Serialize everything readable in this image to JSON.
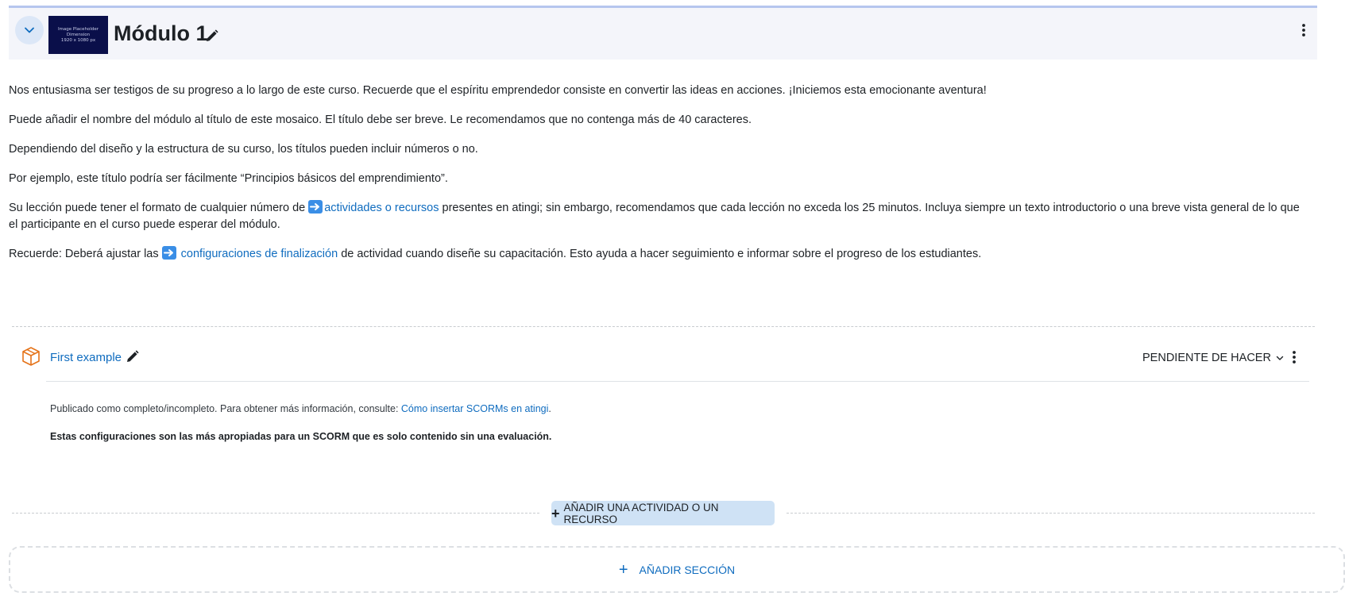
{
  "section": {
    "title": "Módulo 1",
    "thumbnail_text": "Image Placeholder\nDimension\n1920 x 1080 px"
  },
  "summary": {
    "p1": "Nos entusiasma ser testigos de su progreso a lo largo de este curso. Recuerde que el espíritu emprendedor consiste en convertir las ideas en acciones. ¡Iniciemos esta emocionante aventura!",
    "p2": "Puede añadir el nombre del módulo al título de este mosaico. El título debe ser breve. Le recomendamos que no contenga más de 40 caracteres.",
    "p3": "Dependiendo del diseño y la estructura de su curso, los títulos pueden incluir números o no.",
    "p4": "Por ejemplo, este título podría ser fácilmente “Principios básicos del emprendimiento”.",
    "p5_before": "Su lección puede tener el formato de cualquier número de ",
    "p5_link": "actividades o recursos",
    "p5_after": " presentes en atingi; sin embargo, recomendamos que cada lección no exceda los 25 minutos. Incluya siempre un texto introductorio o una breve vista general de lo que el participante en el curso puede esperar del módulo.",
    "p6_before": "Recuerde: Deberá ajustar las ",
    "p6_link": "configuraciones de finalización",
    "p6_after": " de actividad cuando diseñe su capacitación. Esto ayuda a hacer seguimiento e informar sobre el progreso de los estudiantes."
  },
  "activity": {
    "name": "First example",
    "completion_label": "PENDIENTE DE HACER",
    "info_text": "Publicado como completo/incompleto. Para obtener más información, consulte: ",
    "info_link": "Cómo insertar SCORMs en atingi",
    "info_period": ".",
    "info_bold": "Estas configuraciones son las más apropiadas para un SCORM que es solo contenido sin una evaluación."
  },
  "buttons": {
    "add_activity": "AÑADIR UNA ACTIVIDAD O UN RECURSO",
    "add_section": "AÑADIR SECCIÓN"
  },
  "colors": {
    "link": "#0f6cbf",
    "header_bg": "#f4f5fa",
    "add_activity_bg": "#cfe2f5",
    "activity_icon": "#e5731a"
  }
}
